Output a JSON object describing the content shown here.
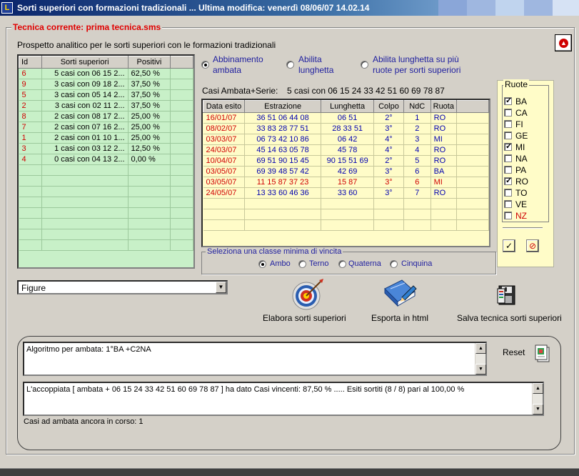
{
  "window": {
    "title": "Sorti superiori con formazioni tradizionali ... Ultima modifica: venerdì 08/06/07 14.02.14",
    "app_icon": "L"
  },
  "group": {
    "title": "Tecnica corrente: prima tecnica.sms",
    "subtitle": "Prospetto analitico per le sorti superiori con le formazioni tradizionali"
  },
  "left_table": {
    "headers": [
      "Id",
      "Sorti superiori",
      "Positivi"
    ],
    "rows": [
      [
        "6",
        "5 casi con 06 15 2...",
        "62,50 %"
      ],
      [
        "9",
        "3 casi con 09 18 2...",
        "37,50 %"
      ],
      [
        "5",
        "3 casi con 05 14 2...",
        "37,50 %"
      ],
      [
        "2",
        "3 casi con 02 11 2...",
        "37,50 %"
      ],
      [
        "8",
        "2 casi con 08 17 2...",
        "25,00 %"
      ],
      [
        "7",
        "2 casi con 07 16 2...",
        "25,00 %"
      ],
      [
        "1",
        "2 casi con 01 10 1...",
        "25,00 %"
      ],
      [
        "3",
        "1 casi con 03 12 2...",
        "12,50 %"
      ],
      [
        "4",
        "0 casi con 04 13 2...",
        "0,00 %"
      ]
    ]
  },
  "options": {
    "abbinamento_label": "Abbinamento ambata",
    "abilita_lunghetta_label": "Abilita lunghetta",
    "abilita_lunghetta_piu_label": "Abilita lunghetta su più ruote per sorti superiori",
    "selected": "abilita_lunghetta_piu"
  },
  "casi": {
    "label": "Casi Ambata+Serie:",
    "value": "5 casi con 06 15 24 33 42 51 60 69 78 87"
  },
  "right_table": {
    "headers": [
      "Data esito",
      "Estrazione",
      "Lunghetta",
      "Colpo",
      "NdC",
      "Ruota"
    ],
    "rows": [
      [
        "16/01/07",
        "36 51 06 44 08",
        "06 51",
        "2°",
        "1",
        "RO"
      ],
      [
        "08/02/07",
        "33 83 28 77 51",
        "28 33 51",
        "3°",
        "2",
        "RO"
      ],
      [
        "03/03/07",
        "06 73 42 10 86",
        "06 42",
        "4°",
        "3",
        "MI"
      ],
      [
        "24/03/07",
        "45 14 63 05 78",
        "45 78",
        "4°",
        "4",
        "RO"
      ],
      [
        "10/04/07",
        "69 51 90 15 45",
        "90 15 51 69",
        "2°",
        "5",
        "RO"
      ],
      [
        "03/05/07",
        "69 39 48 57 42",
        "42 69",
        "3°",
        "6",
        "BA"
      ],
      [
        "03/05/07",
        "11 15 87 37 23",
        "15 87",
        "3°",
        "6",
        "MI"
      ],
      [
        "24/05/07",
        "13 33 60 46 36",
        "33 60",
        "3°",
        "7",
        "RO"
      ]
    ]
  },
  "classe": {
    "title": "Seleziona una classe minima di vincita",
    "options": [
      "Ambo",
      "Terno",
      "Quaterna",
      "Cinquina"
    ],
    "selected": "Ambo"
  },
  "ruote": {
    "title": "Ruote",
    "items": [
      {
        "label": "BA",
        "checked": true
      },
      {
        "label": "CA",
        "checked": false
      },
      {
        "label": "FI",
        "checked": false
      },
      {
        "label": "GE",
        "checked": false
      },
      {
        "label": "MI",
        "checked": true
      },
      {
        "label": "NA",
        "checked": false
      },
      {
        "label": "PA",
        "checked": false
      },
      {
        "label": "RO",
        "checked": true
      },
      {
        "label": "TO",
        "checked": false
      },
      {
        "label": "VE",
        "checked": false
      },
      {
        "label": "NZ",
        "checked": false
      }
    ],
    "check_all_glyph": "✓",
    "uncheck_all_glyph": "⊘"
  },
  "combo": {
    "value": "Figure"
  },
  "actions": {
    "elabora_label": "Elabora sorti superiori",
    "esporta_label": "Esporta in html",
    "salva_label": "Salva tecnica sorti superiori"
  },
  "bottom": {
    "algoritmo": "Algoritmo per ambata: 1°BA +C2NA",
    "reset_label": "Reset",
    "accoppiata": "L'accoppiata [ ambata + 06 15 24 33 42 51 60 69 78 87 ] ha dato  Casi vincenti: 87,50 % ..... Esiti sortiti (8 / 8) pari al 100,00 %",
    "casi_corso": "Casi ad ambata ancora in corso:  1"
  },
  "colors": {
    "title_bar": "#0a246a",
    "left_grid_bg": "#c8f0c8",
    "right_grid_bg": "#fffcc8",
    "accent_red": "#d00000",
    "accent_blue": "#0000b0"
  }
}
